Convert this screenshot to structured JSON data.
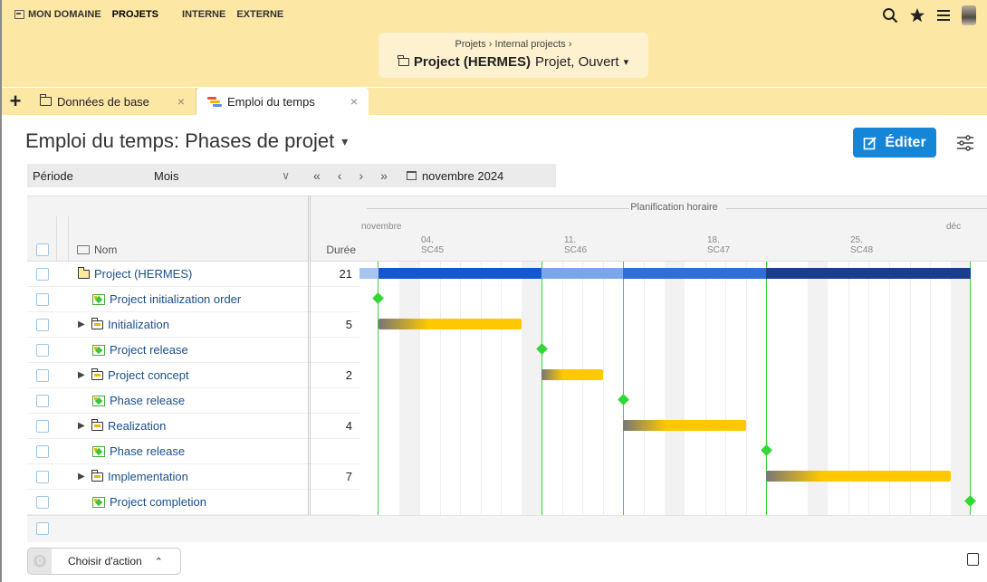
{
  "topnav": {
    "items": [
      {
        "label": "MON DOMAINE"
      },
      {
        "label": "PROJETS"
      },
      {
        "label": "INTERNE"
      },
      {
        "label": "EXTERNE"
      }
    ],
    "icons": [
      "search-icon",
      "star-icon",
      "menu-icon",
      "avatar"
    ]
  },
  "project": {
    "breadcrumb": "Projets  ›  Internal projects  ›",
    "name": "Project (HERMES)",
    "status": "Projet, Ouvert"
  },
  "tabs": [
    {
      "label": "Données de base",
      "icon": "folder-icon"
    },
    {
      "label": "Emploi du temps",
      "icon": "gantt-icon"
    }
  ],
  "page": {
    "title": "Emploi du temps: Phases de projet",
    "edit_label": "Éditer"
  },
  "filter": {
    "period_label": "Période",
    "period_value": "Mois",
    "nav": [
      "«",
      "‹",
      "›",
      "»"
    ],
    "date": "novembre 2024"
  },
  "table": {
    "col_name": "Nom",
    "col_duration": "Durée",
    "rows": [
      {
        "name": "Project (HERMES)",
        "type": "project",
        "duration": "21",
        "expandable": false
      },
      {
        "name": "Project initialization order",
        "type": "milestone",
        "duration": "",
        "expandable": false
      },
      {
        "name": "Initialization",
        "type": "phase",
        "duration": "5",
        "expandable": true
      },
      {
        "name": "Project release",
        "type": "milestone",
        "duration": "",
        "expandable": false
      },
      {
        "name": "Project concept",
        "type": "phase",
        "duration": "2",
        "expandable": true
      },
      {
        "name": "Phase release",
        "type": "milestone",
        "duration": "",
        "expandable": false
      },
      {
        "name": "Realization",
        "type": "phase",
        "duration": "4",
        "expandable": true
      },
      {
        "name": "Phase release",
        "type": "milestone",
        "duration": "",
        "expandable": false
      },
      {
        "name": "Implementation",
        "type": "phase",
        "duration": "7",
        "expandable": true
      },
      {
        "name": "Project completion",
        "type": "milestone",
        "duration": "",
        "expandable": false
      }
    ]
  },
  "timeline": {
    "title": "Planification horaire",
    "month_start": "novembre",
    "month_next": "déc",
    "weeks": [
      {
        "date": "04.",
        "week": "SC45"
      },
      {
        "date": "11.",
        "week": "SC46"
      },
      {
        "date": "18.",
        "week": "SC47"
      },
      {
        "date": "25.",
        "week": "SC48"
      }
    ]
  },
  "footer": {
    "count": "0",
    "action_label": "Choisir d'action"
  },
  "colors": {
    "accent": "#1585d8",
    "topbar": "#fde7a5",
    "phase_bar": "#ffc800",
    "project_bar": "#1457cf",
    "milestone": "#33d633"
  }
}
